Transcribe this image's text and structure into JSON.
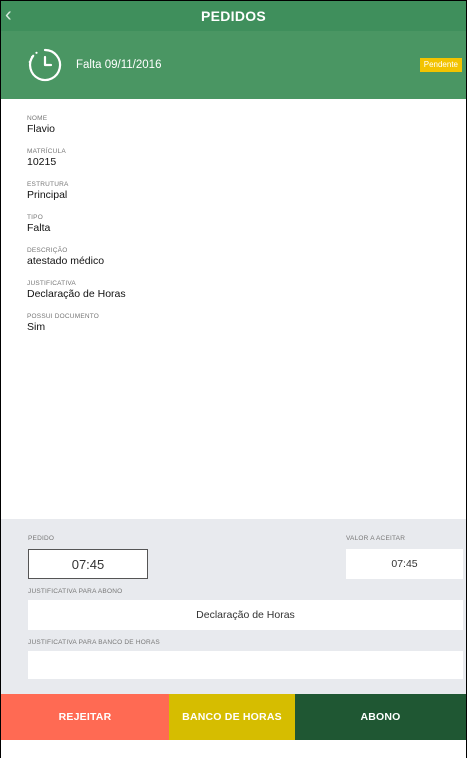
{
  "topbar": {
    "title": "PEDIDOS",
    "back_icon": "chevron-left-icon"
  },
  "header": {
    "icon": "clock-icon",
    "subtitle": "Falta 09/11/2016",
    "status": "Pendente",
    "status_color": "#f2c300"
  },
  "details": [
    {
      "label": "NOME",
      "value": "Flavio"
    },
    {
      "label": "MATRÍCULA",
      "value": "10215"
    },
    {
      "label": "ESTRUTURA",
      "value": "Principal"
    },
    {
      "label": "TIPO",
      "value": "Falta"
    },
    {
      "label": "DESCRIÇÃO",
      "value": "atestado médico"
    },
    {
      "label": "JUSTIFICATIVA",
      "value": "Declaração de Horas"
    },
    {
      "label": "POSSUI DOCUMENTO",
      "value": "Sim"
    }
  ],
  "form": {
    "pedido_label": "PEDIDO",
    "pedido_value": "07:45",
    "valor_label": "VALOR A ACEITAR",
    "valor_value": "07:45",
    "abono_label": "JUSTIFICATIVA PARA ABONO",
    "abono_value": "Declaração de Horas",
    "banco_label": "JUSTIFICATIVA PARA BANCO DE HORAS",
    "banco_value": ""
  },
  "actions": {
    "reject_label": "REJEITAR",
    "banco_label": "BANCO DE HORAS",
    "abono_label": "ABONO"
  },
  "colors": {
    "reject": "#ff6a53",
    "banco": "#d6bd00",
    "abono": "#1f5733",
    "header": "#4a9663"
  }
}
